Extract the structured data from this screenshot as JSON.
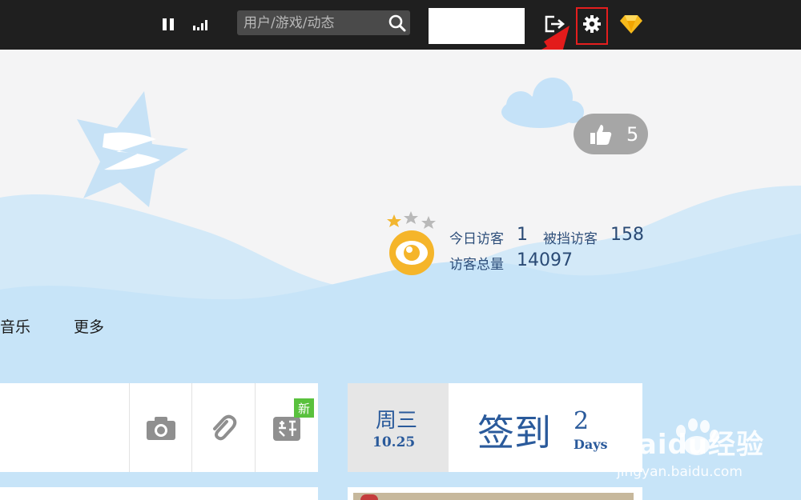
{
  "topbar": {
    "search": {
      "placeholder": "用户/游戏/动态"
    }
  },
  "cover": {
    "like_count": "5",
    "visitors": {
      "today_label": "今日访客",
      "today_value": "1",
      "blocked_label": "被挡访客",
      "blocked_value": "158",
      "total_label": "访客总量",
      "total_value": "14097"
    }
  },
  "nav": {
    "items": [
      "音乐",
      "更多"
    ]
  },
  "tools": {
    "new_badge": "新"
  },
  "signin": {
    "weekday": "周三",
    "date": "10.25",
    "button": "签到",
    "days_count": "2",
    "days_label": "Days"
  },
  "watermark": {
    "brand": "Baidu经验",
    "url": "jingyan.baidu.com"
  },
  "colors": {
    "topbar": "#1f1f1f",
    "accent_blue": "#2a5a9b",
    "highlight_red": "#e41e1e",
    "new_green": "#59c13d"
  }
}
